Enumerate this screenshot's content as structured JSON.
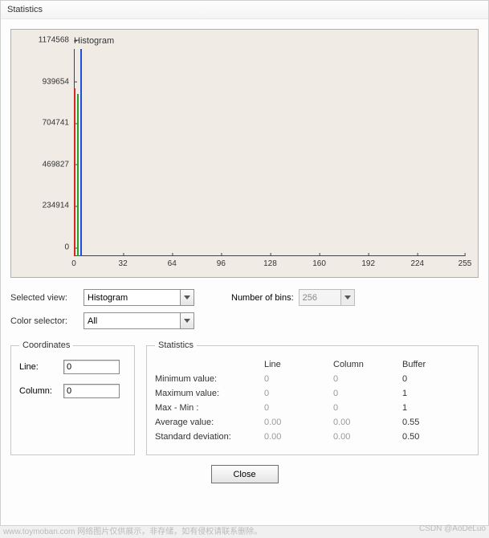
{
  "window": {
    "title": "Statistics"
  },
  "chart_data": {
    "type": "bar",
    "title": "Histogram",
    "xlabel": "",
    "ylabel": "",
    "xlim": [
      0,
      255
    ],
    "ylim": [
      0,
      1174568
    ],
    "x_ticks": [
      0,
      32,
      64,
      96,
      128,
      160,
      192,
      224,
      255
    ],
    "y_ticks": [
      0,
      234914,
      469827,
      704741,
      939654,
      1174568
    ],
    "series": [
      {
        "name": "red",
        "color": "#d62728",
        "x": 0,
        "value": 950000
      },
      {
        "name": "green",
        "color": "#2ca02c",
        "x": 1,
        "value": 920000
      },
      {
        "name": "blue",
        "color": "#1f4fd6",
        "x": 2,
        "value": 1174568
      }
    ]
  },
  "controls": {
    "selected_view_label": "Selected view:",
    "selected_view_value": "Histogram",
    "bins_label": "Number of bins:",
    "bins_value": "256",
    "color_selector_label": "Color selector:",
    "color_selector_value": "All"
  },
  "coords": {
    "legend": "Coordinates",
    "line_label": "Line:",
    "line_value": "0",
    "column_label": "Column:",
    "column_value": "0"
  },
  "stats": {
    "legend": "Statistics",
    "headers": {
      "line": "Line",
      "column": "Column",
      "buffer": "Buffer"
    },
    "rows": [
      {
        "label": "Minimum value:",
        "line": "0",
        "column": "0",
        "buffer": "0"
      },
      {
        "label": "Maximum value:",
        "line": "0",
        "column": "0",
        "buffer": "1"
      },
      {
        "label": "Max - Min :",
        "line": "0",
        "column": "0",
        "buffer": "1"
      },
      {
        "label": "Average value:",
        "line": "0.00",
        "column": "0.00",
        "buffer": "0.55"
      },
      {
        "label": "Standard deviation:",
        "line": "0.00",
        "column": "0.00",
        "buffer": "0.50"
      }
    ]
  },
  "buttons": {
    "close": "Close"
  },
  "watermark": {
    "left": "www.toymoban.com 网络图片仅供展示，非存储，如有侵权请联系删除。",
    "right": "CSDN @AoDeLuo"
  }
}
